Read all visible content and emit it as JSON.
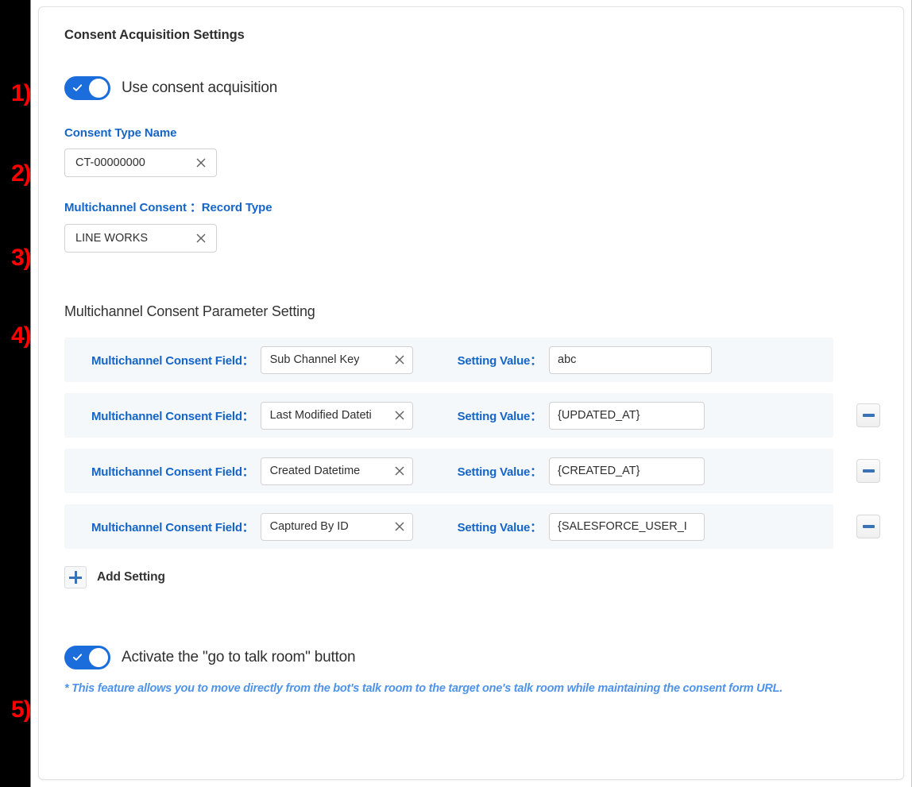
{
  "card": {
    "title": "Consent Acquisition Settings"
  },
  "use_consent": {
    "label": "Use consent acquisition",
    "state": "on",
    "icon": "check-icon"
  },
  "consent_type": {
    "label": "Consent Type Name",
    "value": "CT-00000000",
    "clear_icon": "close-icon"
  },
  "record_type": {
    "label": "Multichannel Consent ：Record Type",
    "value": "LINE WORKS",
    "clear_icon": "close-icon"
  },
  "parameter_section": {
    "heading": "Multichannel Consent Parameter Setting",
    "field_label": "Multichannel Consent Field：",
    "value_label": "Setting Value：",
    "rows": [
      {
        "field": "Sub Channel Key",
        "value": "abc",
        "removable": false
      },
      {
        "field": "Last Modified Dateti",
        "value": "{UPDATED_AT}",
        "removable": true
      },
      {
        "field": "Created Datetime",
        "value": "{CREATED_AT}",
        "removable": true
      },
      {
        "field": "Captured By ID",
        "value": "{SALESFORCE_USER_I",
        "removable": true
      }
    ],
    "add_label": "Add Setting",
    "add_icon": "plus-icon",
    "remove_icon": "minus-icon"
  },
  "talk_room": {
    "label": "Activate the \"go to talk room\" button",
    "state": "on",
    "icon": "check-icon",
    "note": "* This feature allows you to move directly from the bot's talk room to the target one's talk room while maintaining the consent form URL."
  },
  "markers": [
    {
      "label": "1)"
    },
    {
      "label": "2)"
    },
    {
      "label": "3)"
    },
    {
      "label": "4)"
    },
    {
      "label": "5)"
    }
  ],
  "colors": {
    "accent_blue": "#1565c8",
    "toggle_blue": "#1b6ddb",
    "row_bg": "#f4f8fa",
    "note_blue": "#4f93e8",
    "marker_red": "#ff0000"
  }
}
